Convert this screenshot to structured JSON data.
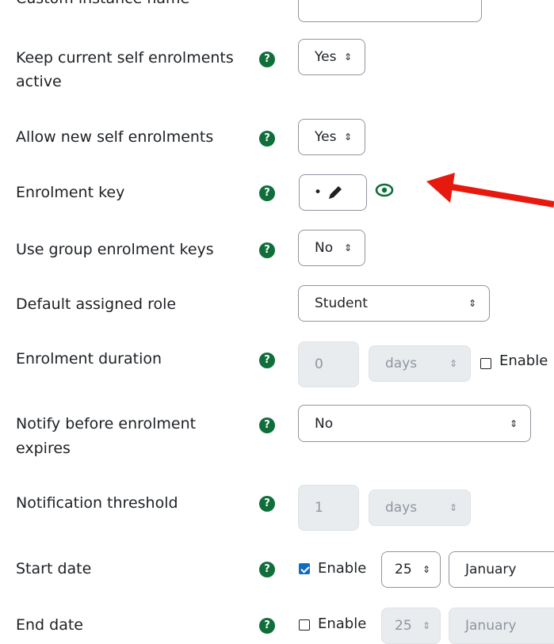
{
  "custom_instance_name": {
    "label": "Custom instance name",
    "value": ""
  },
  "keep_current": {
    "label_line1": "Keep current self enrolments",
    "label_line2": "active",
    "value": "Yes"
  },
  "allow_new": {
    "label": "Allow new self enrolments",
    "value": "Yes"
  },
  "enrolment_key": {
    "label": "Enrolment key",
    "value": "•"
  },
  "group_keys": {
    "label": "Use group enrolment keys",
    "value": "No"
  },
  "default_role": {
    "label": "Default assigned role",
    "value": "Student"
  },
  "duration": {
    "label": "Enrolment duration",
    "value": "0",
    "unit": "days",
    "enable_label": "Enable"
  },
  "notify": {
    "label_line1": "Notify before enrolment",
    "label_line2": "expires",
    "value": "No"
  },
  "threshold": {
    "label": "Notification threshold",
    "value": "1",
    "unit": "days"
  },
  "start_date": {
    "label": "Start date",
    "enable_label": "Enable",
    "enabled": true,
    "day": "25",
    "month": "January"
  },
  "end_date": {
    "label": "End date",
    "enable_label": "Enable",
    "enabled": false,
    "day": "25",
    "month": "January"
  },
  "help_glyph": "?",
  "select_arrows": "⇕",
  "colors": {
    "help_icon": "#0f6e3a",
    "arrow": "#e6190f",
    "checkbox": "#0f6cbf"
  },
  "icons": {
    "help": "question-circle-icon",
    "edit": "pencil-icon",
    "reveal": "eye-icon",
    "annotation": "red-arrow"
  }
}
